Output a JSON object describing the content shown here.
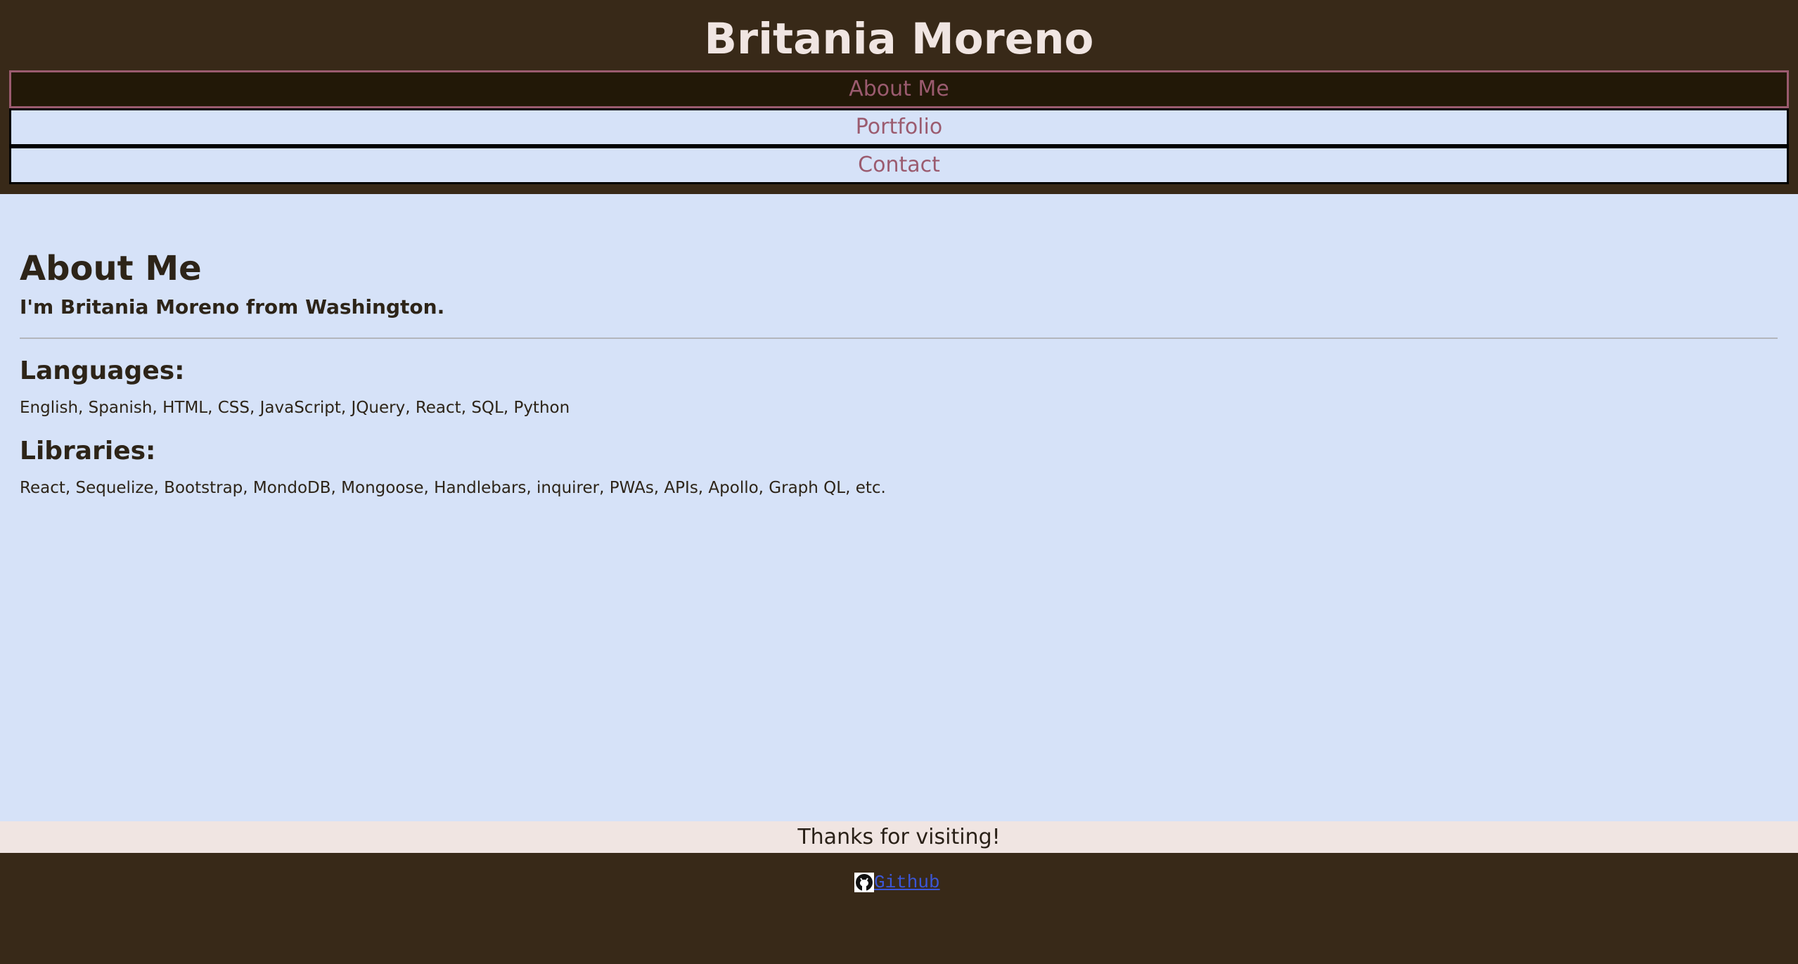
{
  "header": {
    "title": "Britania Moreno",
    "nav": [
      {
        "label": "About Me",
        "active": true
      },
      {
        "label": "Portfolio",
        "active": false
      },
      {
        "label": "Contact",
        "active": false
      }
    ]
  },
  "main": {
    "heading": "About Me",
    "intro": "I'm Britania Moreno from Washington.",
    "languages_heading": "Languages:",
    "languages_text": "English, Spanish, HTML, CSS, JavaScript, JQuery, React, SQL, Python",
    "libraries_heading": "Libraries:",
    "libraries_text": "React, Sequelize, Bootstrap, MondoDB, Mongoose, Handlebars, inquirer, PWAs, APIs, Apollo, Graph QL, etc."
  },
  "footer": {
    "thanks": "Thanks for visiting!",
    "github_label": "Github",
    "github_icon": "github-icon"
  },
  "colors": {
    "header_bg": "#382918",
    "nav_active_bg": "#221807",
    "nav_bg": "#d6e2f8",
    "nav_text": "#9b5b6f",
    "title_text": "#f0e5e2",
    "main_bg": "#d6e2f8",
    "thanks_bg": "#f0e5e2",
    "link": "#3b56d6"
  }
}
